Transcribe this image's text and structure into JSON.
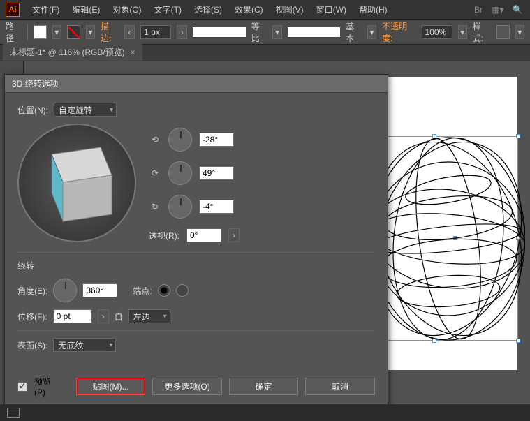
{
  "menu": {
    "file": "文件(F)",
    "edit": "编辑(E)",
    "object": "对象(O)",
    "type": "文字(T)",
    "select": "选择(S)",
    "effect": "效果(C)",
    "view": "视图(V)",
    "window": "窗口(W)",
    "help": "帮助(H)"
  },
  "optbar": {
    "mode": "路径",
    "stroke_label": "描边:",
    "stroke_width": "1 px",
    "profile_label": "等比",
    "brush_label": "基本",
    "opacity_label": "不透明度:",
    "opacity_value": "100%",
    "style_label": "样式:"
  },
  "tab": {
    "title": "未标题-1* @ 116% (RGB/预览)"
  },
  "dialog": {
    "title": "3D 绕转选项",
    "position_label": "位置(N):",
    "position_value": "自定旋转",
    "rot_x": "-28°",
    "rot_y": "49°",
    "rot_z": "-4°",
    "perspective_label": "透视(R):",
    "perspective_value": "0°",
    "revolve_section": "绕转",
    "angle_label": "角度(E):",
    "angle_value": "360°",
    "cap_label": "端点:",
    "offset_label": "位移(F):",
    "offset_value": "0 pt",
    "from_label": "自",
    "from_value": "左边",
    "surface_label": "表面(S):",
    "surface_value": "无底纹",
    "preview_label": "预览(P)",
    "map_art_btn": "贴图(M)...",
    "more_options_btn": "更多选项(O)",
    "ok_btn": "确定",
    "cancel_btn": "取消"
  },
  "logo": "Ai"
}
